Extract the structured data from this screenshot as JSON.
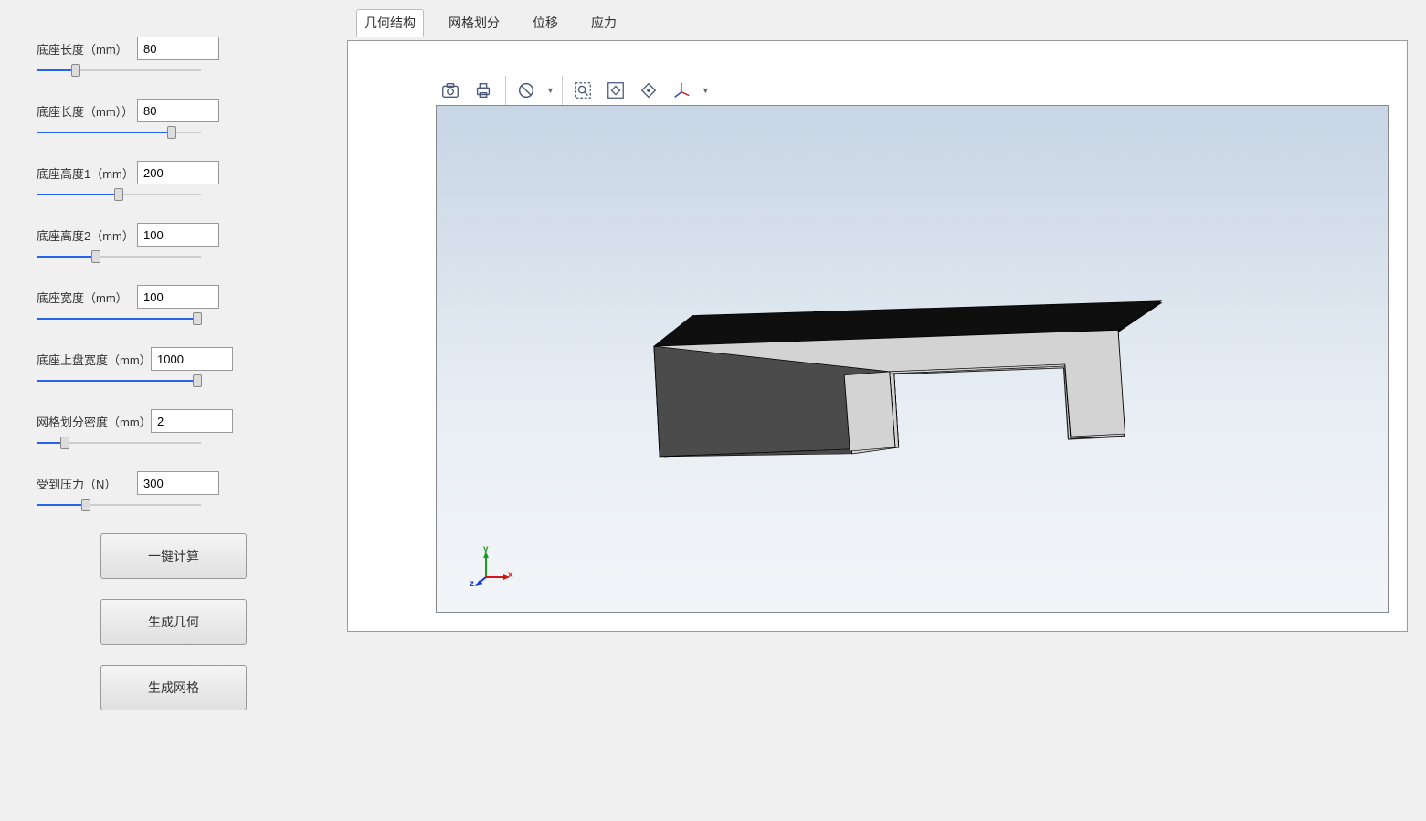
{
  "params": [
    {
      "label": "底座长度（mm）",
      "value": "80",
      "slider": 24,
      "wide": false
    },
    {
      "label": "底座长度（mm））",
      "value": "80",
      "slider": 82,
      "wide": false
    },
    {
      "label": "底座高度1（mm）",
      "value": "200",
      "slider": 50,
      "wide": false
    },
    {
      "label": "底座高度2（mm）",
      "value": "100",
      "slider": 36,
      "wide": false
    },
    {
      "label": "底座宽度（mm）",
      "value": "100",
      "slider": 98,
      "wide": false
    },
    {
      "label": "底座上盘宽度（mm）",
      "value": "1000",
      "slider": 98,
      "wide": true
    },
    {
      "label": "网格划分密度（mm）",
      "value": "2",
      "slider": 17,
      "wide": true
    },
    {
      "label": "受到压力（N）",
      "value": "300",
      "slider": 30,
      "wide": false
    }
  ],
  "buttons": {
    "calc": "一键计算",
    "gen_geom": "生成几何",
    "gen_mesh": "生成网格"
  },
  "tabs": [
    "几何结构",
    "网格划分",
    "位移",
    "应力"
  ],
  "active_tab": 0,
  "axis_labels": {
    "x": "x",
    "y": "y",
    "z": "z"
  }
}
